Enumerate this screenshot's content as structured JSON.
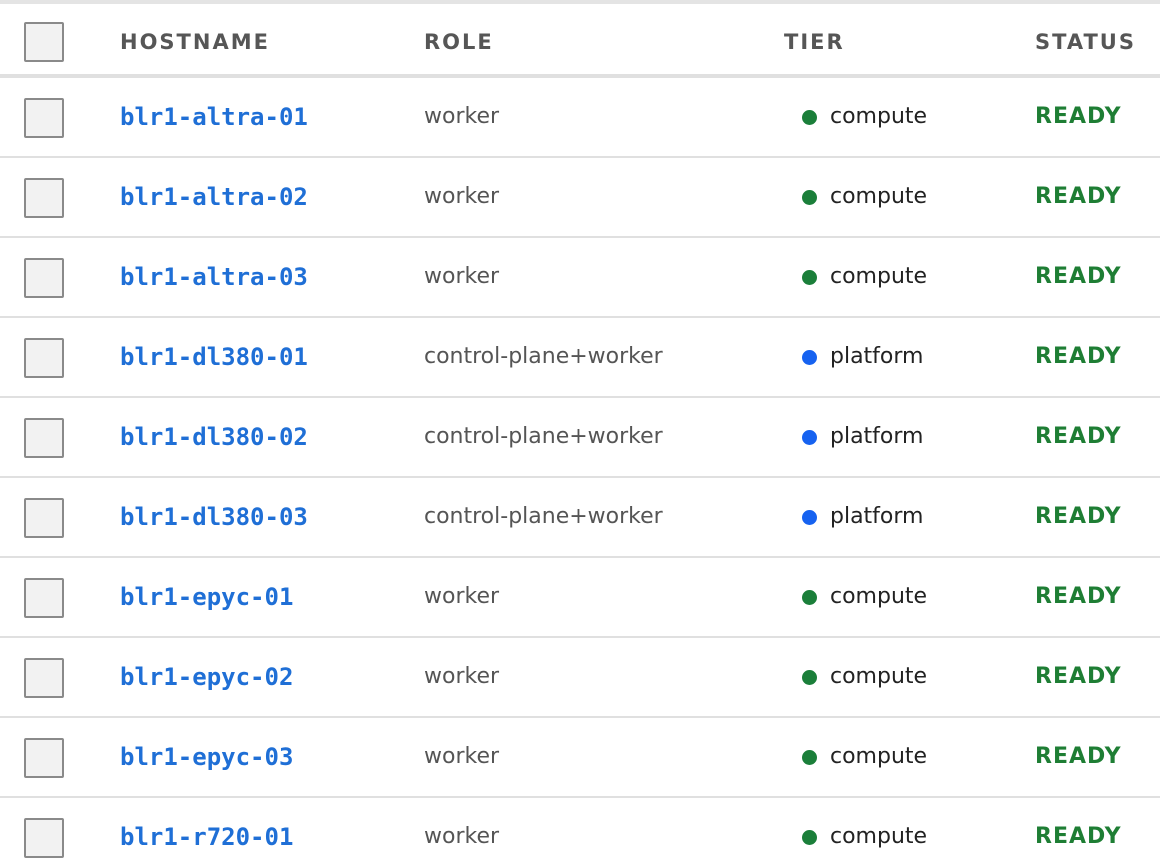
{
  "header": {
    "hostname": "HOSTNAME",
    "role": "ROLE",
    "tier": "TIER",
    "status": "STATUS"
  },
  "tier_colors": {
    "compute": "#1b7f3a",
    "platform": "#1662f0"
  },
  "colors": {
    "link": "#1f6fd6",
    "ready": "#1e7e34"
  },
  "rows": [
    {
      "hostname": "blr1-altra-01",
      "role": "worker",
      "tier": "compute",
      "status": "READY"
    },
    {
      "hostname": "blr1-altra-02",
      "role": "worker",
      "tier": "compute",
      "status": "READY"
    },
    {
      "hostname": "blr1-altra-03",
      "role": "worker",
      "tier": "compute",
      "status": "READY"
    },
    {
      "hostname": "blr1-dl380-01",
      "role": "control-plane+worker",
      "tier": "platform",
      "status": "READY"
    },
    {
      "hostname": "blr1-dl380-02",
      "role": "control-plane+worker",
      "tier": "platform",
      "status": "READY"
    },
    {
      "hostname": "blr1-dl380-03",
      "role": "control-plane+worker",
      "tier": "platform",
      "status": "READY"
    },
    {
      "hostname": "blr1-epyc-01",
      "role": "worker",
      "tier": "compute",
      "status": "READY"
    },
    {
      "hostname": "blr1-epyc-02",
      "role": "worker",
      "tier": "compute",
      "status": "READY"
    },
    {
      "hostname": "blr1-epyc-03",
      "role": "worker",
      "tier": "compute",
      "status": "READY"
    },
    {
      "hostname": "blr1-r720-01",
      "role": "worker",
      "tier": "compute",
      "status": "READY"
    }
  ]
}
